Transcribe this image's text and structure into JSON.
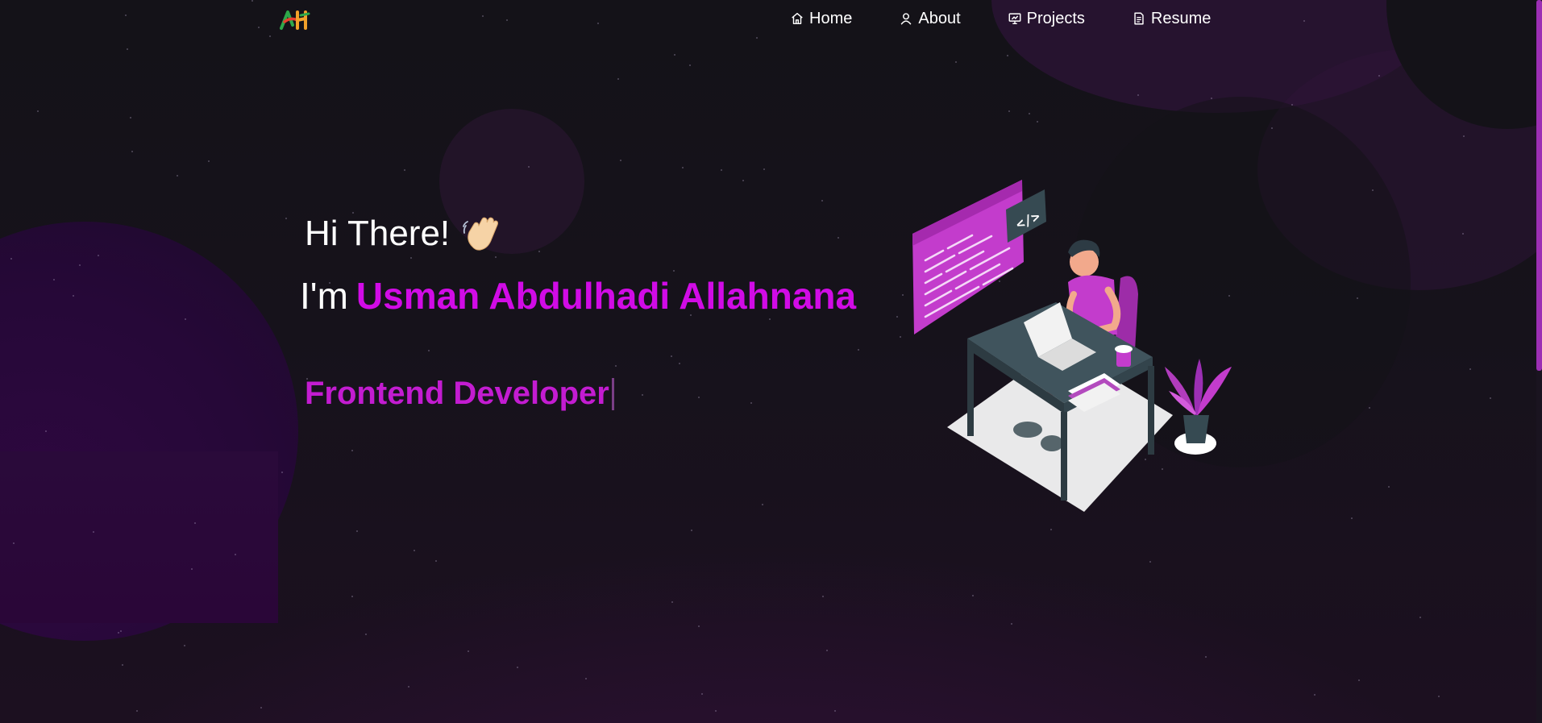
{
  "logo": {
    "text": "AH"
  },
  "nav": {
    "items": [
      {
        "label": "Home",
        "icon": "home-icon"
      },
      {
        "label": "About",
        "icon": "user-icon"
      },
      {
        "label": "Projects",
        "icon": "presentation-icon"
      },
      {
        "label": "Resume",
        "icon": "document-icon"
      }
    ]
  },
  "hero": {
    "greeting": "Hi There!",
    "intro_prefix": "I'm",
    "name": "Usman Abdulhadi Allahnana",
    "role": "Frontend Developer",
    "wave_icon": "waving-hand-icon",
    "illustration": "developer-at-desk-illustration"
  },
  "colors": {
    "accent_name": "#d10be6",
    "accent_role": "#c31cd1",
    "background": "#141218",
    "scrollbar": "#9c2fb4"
  }
}
